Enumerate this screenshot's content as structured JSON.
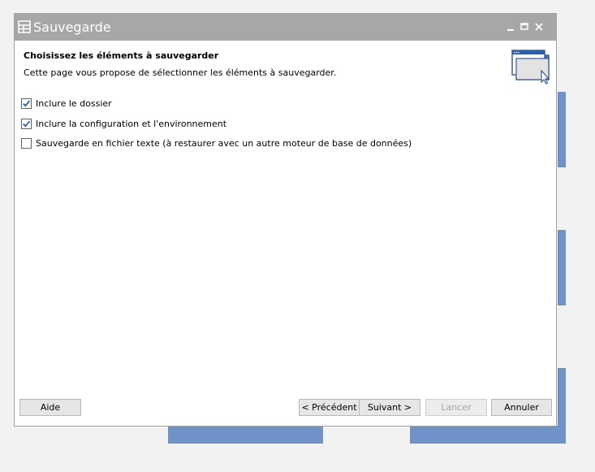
{
  "window": {
    "title": "Sauvegarde"
  },
  "header": {
    "title": "Choisissez les éléments à sauvegarder",
    "description": "Cette page vous propose de sélectionner les éléments à sauvegarder."
  },
  "options": [
    {
      "label": "Inclure le dossier",
      "checked": true
    },
    {
      "label": "Inclure la configuration et l'environnement",
      "checked": true
    },
    {
      "label": "Sauvegarde en fichier texte (à restaurer avec un autre moteur de base de données)",
      "checked": false
    }
  ],
  "buttons": {
    "help": "Aide",
    "previous": "< Précédent",
    "next": "Suivant >",
    "launch": "Lancer",
    "cancel": "Annuler"
  },
  "colors": {
    "titlebar": "#a7a7a7",
    "background_blocks": "#6f93c9",
    "checkmark": "#1f5fa8"
  },
  "icons": {
    "app": "window-grid-icon",
    "wizard": "windows-cursor-icon",
    "minimize": "minimize-icon",
    "maximize": "maximize-icon",
    "close": "close-icon"
  }
}
